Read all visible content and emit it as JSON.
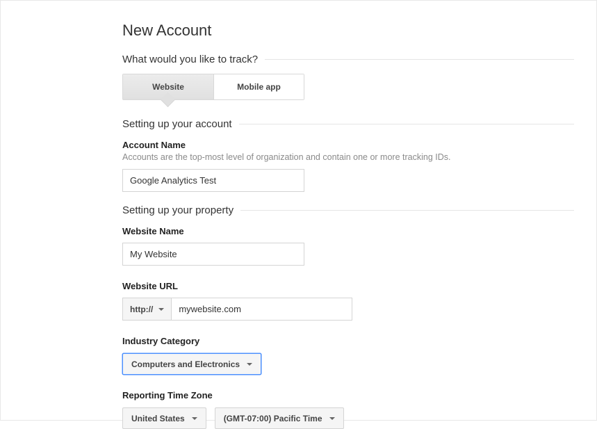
{
  "page": {
    "title": "New Account"
  },
  "track": {
    "question": "What would you like to track?",
    "website": "Website",
    "mobile": "Mobile app"
  },
  "account": {
    "section": "Setting up your account",
    "label": "Account Name",
    "desc": "Accounts are the top-most level of organization and contain one or more tracking IDs.",
    "value": "Google Analytics Test"
  },
  "property": {
    "section": "Setting up your property",
    "website_name_label": "Website Name",
    "website_name_value": "My Website",
    "url_label": "Website URL",
    "protocol": "http://",
    "url_value": "mywebsite.com",
    "industry_label": "Industry Category",
    "industry_value": "Computers and Electronics",
    "tz_label": "Reporting Time Zone",
    "tz_country": "United States",
    "tz_value": "(GMT-07:00) Pacific Time"
  }
}
